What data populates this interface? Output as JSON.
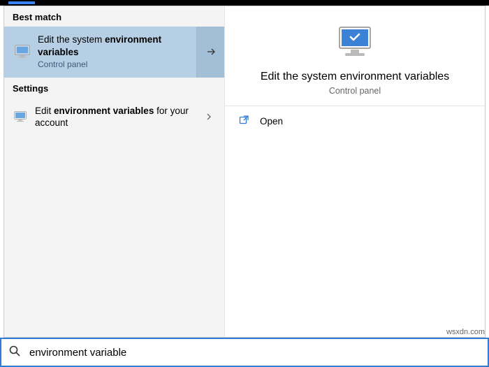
{
  "sections": {
    "best_match_header": "Best match",
    "settings_header": "Settings"
  },
  "best_match": {
    "title_pre": "Edit the system ",
    "title_bold": "environment variables",
    "category": "Control panel"
  },
  "settings_item": {
    "pre": "Edit ",
    "bold": "environment variables",
    "post": " for your account"
  },
  "preview": {
    "title": "Edit the system environment variables",
    "category": "Control panel"
  },
  "actions": {
    "open": "Open"
  },
  "search": {
    "value": "environment variable"
  },
  "watermark": "wsxdn.com"
}
